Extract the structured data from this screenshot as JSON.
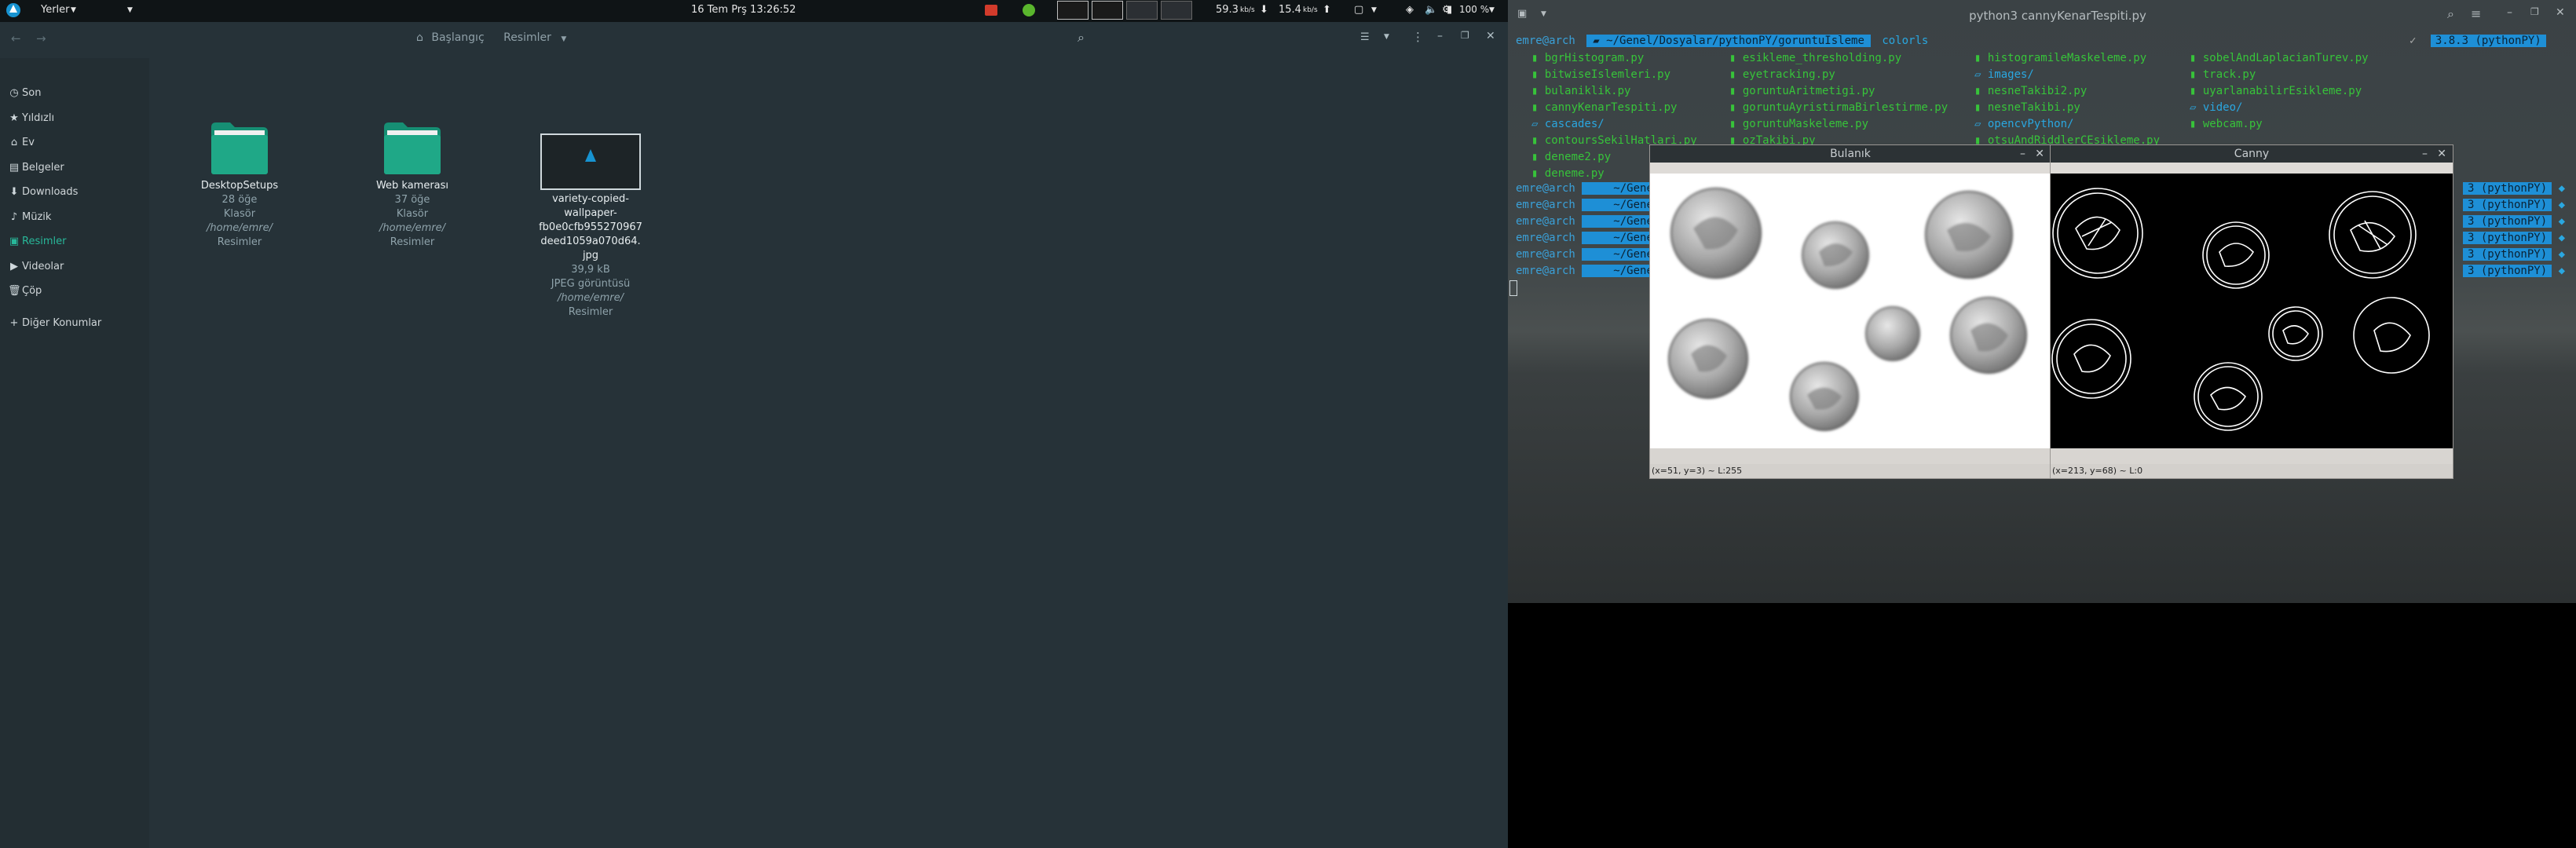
{
  "panel": {
    "places_label": "Yerler",
    "clock": "16 Tem Prş  13:26:52",
    "net_down": "59.3",
    "net_down_unit": "kb/s",
    "net_up": "15.4",
    "net_up_unit": "kb/s",
    "battery": "100 %",
    "colors": {
      "bg": "#0f1416",
      "accent_red": "#d23b2b",
      "accent_green": "#5ab62d"
    }
  },
  "file_manager": {
    "breadcrumb": {
      "home": "Başlangıç",
      "current": "Resimler"
    },
    "sidebar": [
      {
        "label": "Son",
        "icon": "clock-icon"
      },
      {
        "label": "Yıldızlı",
        "icon": "star-icon"
      },
      {
        "label": "Ev",
        "icon": "home-icon"
      },
      {
        "label": "Belgeler",
        "icon": "document-icon"
      },
      {
        "label": "Downloads",
        "icon": "download-icon"
      },
      {
        "label": "Müzik",
        "icon": "music-icon"
      },
      {
        "label": "Resimler",
        "icon": "image-icon",
        "active": true
      },
      {
        "label": "Videolar",
        "icon": "video-icon"
      },
      {
        "label": "Çöp",
        "icon": "trash-icon"
      },
      {
        "label": "Diğer Konumlar",
        "icon": "plus-icon"
      }
    ],
    "items": [
      {
        "name": "DesktopSetups",
        "count": "28 öğe",
        "type": "Klasör",
        "path": "/home/emre/",
        "location": "Resimler"
      },
      {
        "name": "Web kamerası",
        "count": "37 öğe",
        "type": "Klasör",
        "path": "/home/emre/",
        "location": "Resimler"
      },
      {
        "name_lines": [
          "variety-copied-",
          "wallpaper-",
          "fb0e0cfb955270967",
          "deed1059a070d64.",
          "jpg"
        ],
        "size": "39,9 kB",
        "type": "JPEG görüntüsü",
        "path": "/home/emre/",
        "location": "Resimler"
      }
    ],
    "colors": {
      "bg": "#263238",
      "sidebar_bg": "#232e33",
      "accent": "#28b89a",
      "folder": "#1fa887"
    }
  },
  "terminal": {
    "title": "python3 cannyKenarTespiti.py",
    "prompt_user": "emre@arch",
    "prompt_path": "~/Genel/Dosyalar/pythonPY/goruntuIsleme",
    "command": "colorls",
    "venv_badge": "3.8.3 (pythonPY)",
    "venv_short": "3 (pythonPY)",
    "files_col1": [
      "bgrHistogram.py",
      "bitwiseIslemleri.py",
      "bulaniklik.py",
      "cannyKenarTespiti.py",
      "cascades/",
      "contoursSekilHatlari.py",
      "deneme2.py",
      "deneme.py"
    ],
    "files_col2": [
      "esikleme_thresholding.py",
      "eyetracking.py",
      "goruntuAritmetigi.py",
      "goruntuAyristirmaBirlestirme.py",
      "goruntuMaskeleme.py",
      "ozTakibi.py"
    ],
    "files_col3": [
      "histogramileMaskeleme.py",
      "images/",
      "nesneTakibi2.py",
      "nesneTakibi.py",
      "opencvPython/",
      "otsuAndRiddlerCEsikleme.py"
    ],
    "files_col4": [
      "sobelAndLaplacianTurev.py",
      "track.py",
      "uyarlanabilirEsikleme.py",
      "video/",
      "webcam.py"
    ],
    "prompt_repeat_path": "~/Gene",
    "colors": {
      "file": "#37c43a",
      "dir": "#2aa7e0",
      "badge": "#1e8fd6"
    }
  },
  "windows": {
    "blur": {
      "title": "Bulanık",
      "status": "(x=51, y=3) ~ L:255"
    },
    "canny": {
      "title": "Canny",
      "status": "(x=213, y=68) ~ L:0"
    }
  }
}
